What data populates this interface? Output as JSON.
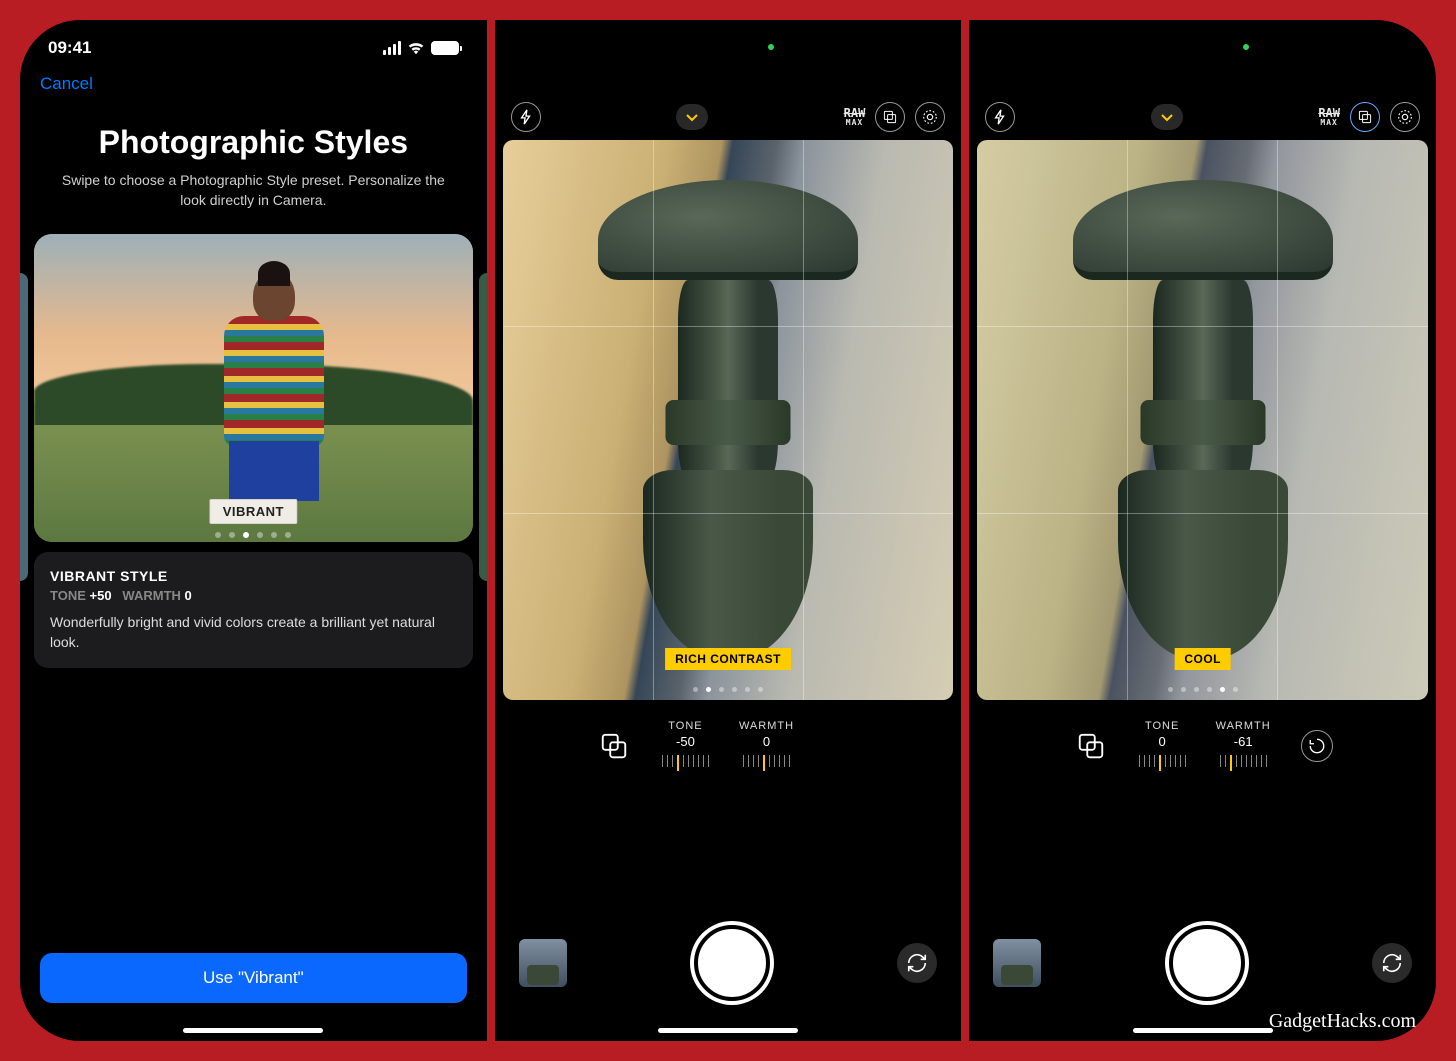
{
  "watermark": "GadgetHacks.com",
  "screen1": {
    "time": "09:41",
    "cancel": "Cancel",
    "title": "Photographic Styles",
    "subtitle": "Swipe to choose a Photographic Style preset. Personalize the look directly in Camera.",
    "preset_label": "VIBRANT",
    "page_index": 2,
    "page_count": 6,
    "style_name": "VIBRANT STYLE",
    "tone_label": "TONE",
    "tone_value": "+50",
    "warmth_label": "WARMTH",
    "warmth_value": "0",
    "description": "Wonderfully bright and vivid colors create a brilliant yet natural look.",
    "button": "Use \"Vibrant\""
  },
  "screen2": {
    "raw": "RAW",
    "raw_sub": "MAX",
    "style_badge": "RICH CONTRAST",
    "page_index": 1,
    "page_count": 6,
    "tone_label": "TONE",
    "tone_value": "-50",
    "warmth_label": "WARMTH",
    "warmth_value": "0"
  },
  "screen3": {
    "raw": "RAW",
    "raw_sub": "MAX",
    "style_badge": "COOL",
    "page_index": 4,
    "page_count": 6,
    "tone_label": "TONE",
    "tone_value": "0",
    "warmth_label": "WARMTH",
    "warmth_value": "-61"
  }
}
